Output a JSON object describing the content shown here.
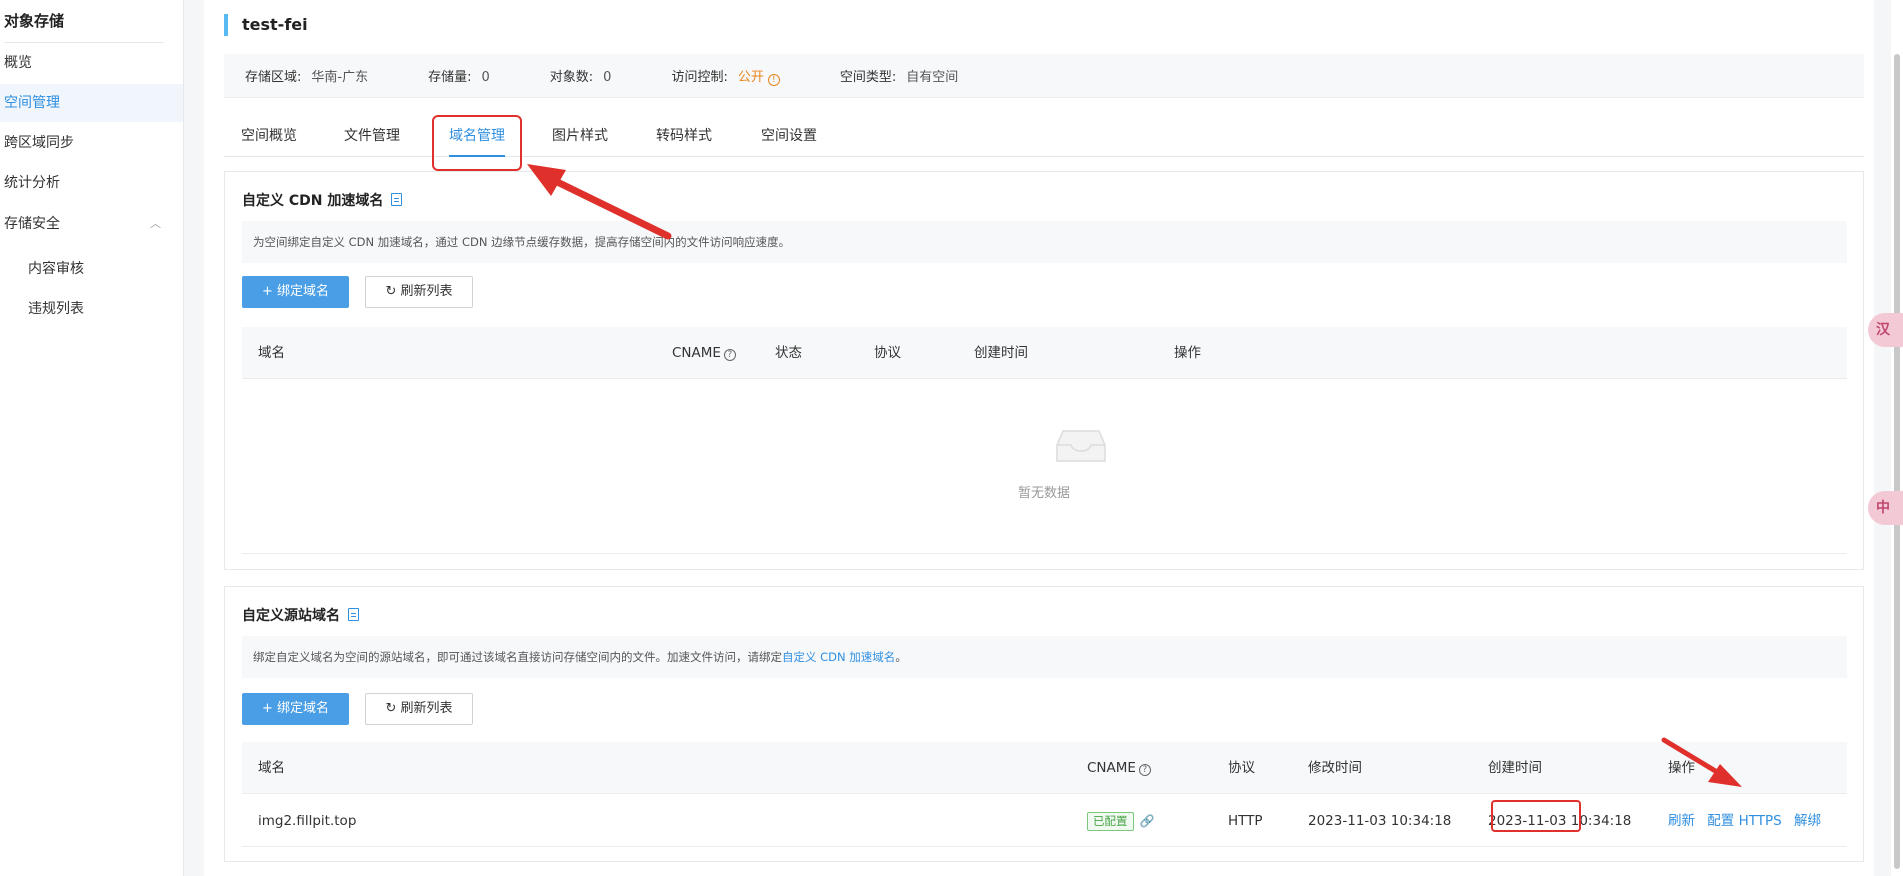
{
  "sidebar": {
    "title": "对象存储",
    "items": [
      {
        "label": "概览"
      },
      {
        "label": "空间管理"
      },
      {
        "label": "跨区域同步"
      },
      {
        "label": "统计分析"
      },
      {
        "label": "存储安全"
      },
      {
        "label": "内容审核"
      },
      {
        "label": "违规列表"
      }
    ]
  },
  "page": {
    "title": "test-fei"
  },
  "info": {
    "region_label": "存储区域:",
    "region": "华南-广东",
    "storage_label": "存储量:",
    "storage": "0",
    "objects_label": "对象数:",
    "objects": "0",
    "access_label": "访问控制:",
    "access": "公开",
    "type_label": "空间类型:",
    "type": "自有空间"
  },
  "tabs": [
    {
      "label": "空间概览"
    },
    {
      "label": "文件管理"
    },
    {
      "label": "域名管理"
    },
    {
      "label": "图片样式"
    },
    {
      "label": "转码样式"
    },
    {
      "label": "空间设置"
    }
  ],
  "cdn": {
    "title": "自定义 CDN 加速域名",
    "desc": "为空间绑定自定义 CDN 加速域名，通过 CDN 边缘节点缓存数据，提高存储空间内的文件访问响应速度。",
    "bind_button": "+ 绑定域名",
    "refresh_button": "刷新列表",
    "columns": [
      "域名",
      "CNAME",
      "状态",
      "协议",
      "创建时间",
      "操作"
    ],
    "empty_text": "暂无数据"
  },
  "origin": {
    "title": "自定义源站域名",
    "desc_prefix": "绑定自定义域名为空间的源站域名，即可通过该域名直接访问存储空间内的文件。加速文件访问，请绑定",
    "desc_link": "自定义 CDN 加速域名",
    "desc_suffix": "。",
    "bind_button": "+ 绑定域名",
    "refresh_button": "刷新列表",
    "columns": [
      "域名",
      "CNAME",
      "协议",
      "修改时间",
      "创建时间",
      "操作"
    ],
    "rows": [
      {
        "domain": "img2.fillpit.top",
        "cname": "已配置",
        "protocol": "HTTP",
        "modified": "2023-11-03 10:34:18",
        "created": "2023-11-03 10:34:18",
        "ops": [
          "刷新",
          "配置 HTTPS",
          "解绑"
        ]
      }
    ]
  },
  "floating": {
    "badge1": "汉",
    "badge2": "中"
  },
  "colors": {
    "accent": "#2f8fe0",
    "highlight": "#e0302c",
    "public": "#e8861c"
  }
}
